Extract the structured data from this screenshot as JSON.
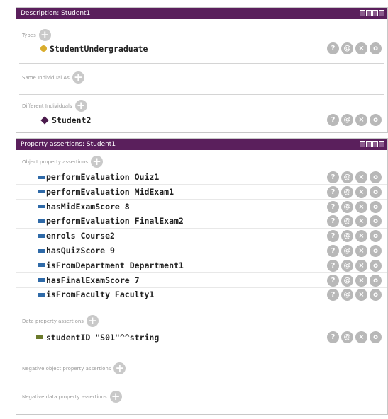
{
  "description_panel": {
    "title": "Description: Student1",
    "types_label": "Types",
    "types": [
      {
        "text": "StudentUndergraduate",
        "icon": "class-dot-icon"
      }
    ],
    "same_individual_label": "Same Individual As",
    "different_individuals_label": "Different Individuals",
    "different_individuals": [
      {
        "text": "Student2",
        "icon": "individual-diamond-icon"
      }
    ]
  },
  "property_panel": {
    "title": "Property assertions: Student1",
    "object_property_label": "Object property assertions",
    "object_properties": [
      {
        "text": "performEvaluation  Quiz1"
      },
      {
        "text": "performEvaluation  MidExam1"
      },
      {
        "text": "hasMidExamScore  8"
      },
      {
        "text": "performEvaluation  FinalExam2"
      },
      {
        "text": "enrols  Course2"
      },
      {
        "text": "hasQuizScore  9"
      },
      {
        "text": "isFromDepartment  Department1"
      },
      {
        "text": "hasFinalExamScore  7"
      },
      {
        "text": "isFromFaculty  Faculty1"
      }
    ],
    "data_property_label": "Data property assertions",
    "data_properties": [
      {
        "text": "studentID  \"S01\"^^string"
      }
    ],
    "negative_object_label": "Negative object property assertions",
    "negative_data_label": "Negative data property assertions"
  },
  "row_icon_glyphs": {
    "info": "?",
    "annotate": "@",
    "delete": "×",
    "edit": "o"
  },
  "plus_glyph": "+",
  "colors": {
    "titlebar": "#5a1f5c",
    "class_dot": "#d9ad2d",
    "individual": "#4a1a4c",
    "object_property": "#2f6aa8",
    "data_property": "#6b7a2b"
  }
}
